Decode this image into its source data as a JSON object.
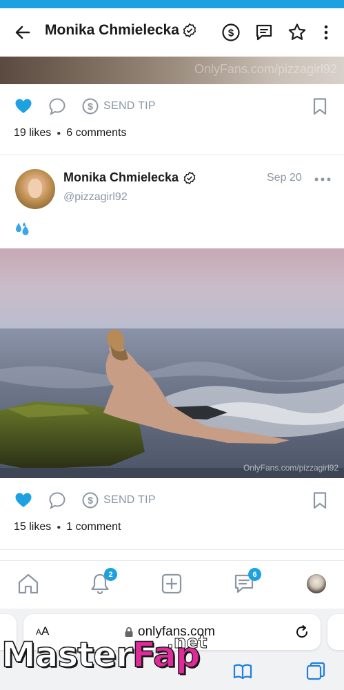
{
  "header": {
    "title": "Monika Chmielecka"
  },
  "previous_post": {
    "watermark": "OnlyFans.com/pizzagirl92",
    "send_tip_label": "SEND TIP",
    "likes": "19 likes",
    "comments": "6 comments"
  },
  "post": {
    "author_name": "Monika Chmielecka",
    "handle": "@pizzagirl92",
    "date": "Sep 20",
    "emoji": "💦",
    "watermark": "OnlyFans.com/pizzagirl92",
    "send_tip_label": "SEND TIP",
    "likes": "15 likes",
    "comments": "1 comment"
  },
  "bottom_nav": {
    "notifications_badge": "2",
    "messages_badge": "6"
  },
  "browser": {
    "text_size_label": "AA",
    "url": "onlyfans.com"
  },
  "overlay_watermark": {
    "part1": "Master",
    "part2": "Fap",
    "suffix": ".net"
  },
  "colors": {
    "accent": "#1da1e0",
    "muted": "#8a96a3",
    "like_active": "#1da1e0"
  }
}
